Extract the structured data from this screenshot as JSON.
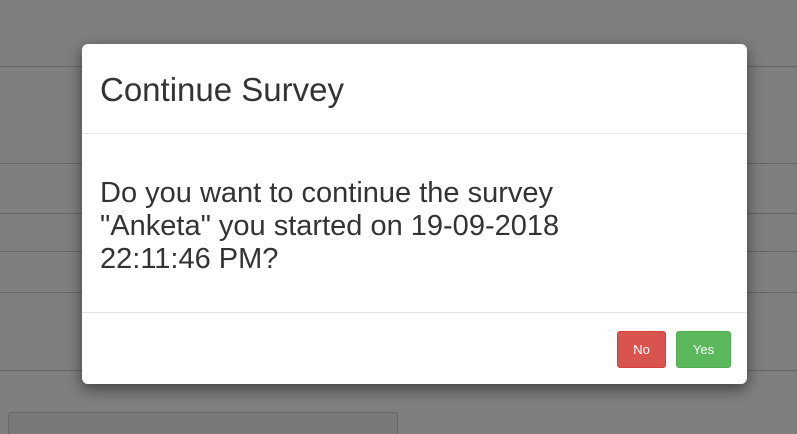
{
  "dialog": {
    "title": "Continue Survey",
    "message": "Do you want to continue the survey \"Anketa\" you started on 19-09-2018 22:11:46 PM?",
    "buttons": {
      "no_label": "No",
      "yes_label": "Yes"
    }
  },
  "colors": {
    "no_button": "#d9534f",
    "yes_button": "#5cb85c",
    "backdrop": "rgba(0,0,0,0.5)"
  }
}
